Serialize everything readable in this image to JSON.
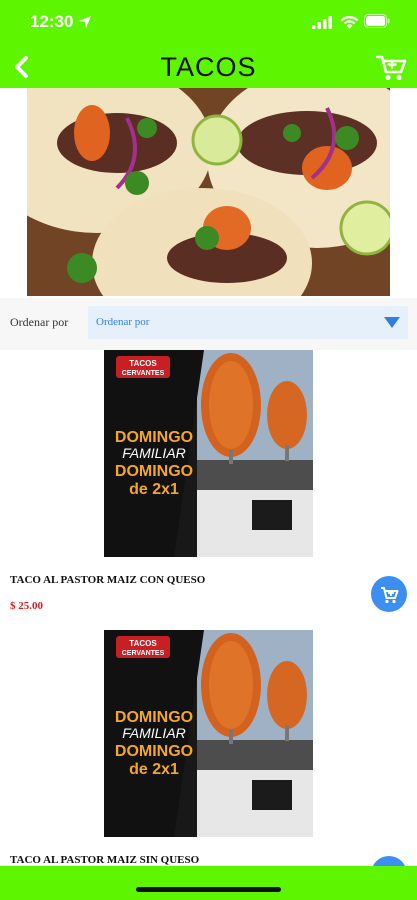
{
  "status": {
    "time": "12:30"
  },
  "header": {
    "title": "TACOS"
  },
  "sort": {
    "label": "Ordenar por",
    "selected": "Ordenar por"
  },
  "promo": {
    "brand_top": "TACOS",
    "brand_bottom": "CERVANTES",
    "line1": "DOMINGO",
    "line2": "FAMILIAR",
    "line3": "DOMINGO",
    "line4": "de 2x1"
  },
  "products": [
    {
      "name": "TACO AL PASTOR MAIZ CON QUESO",
      "price": "$ 25.00"
    },
    {
      "name": "TACO AL PASTOR MAIZ SIN QUESO"
    }
  ],
  "colors": {
    "bar": "#5ef500",
    "accent": "#3c8ff0",
    "price": "#e01b1b"
  }
}
